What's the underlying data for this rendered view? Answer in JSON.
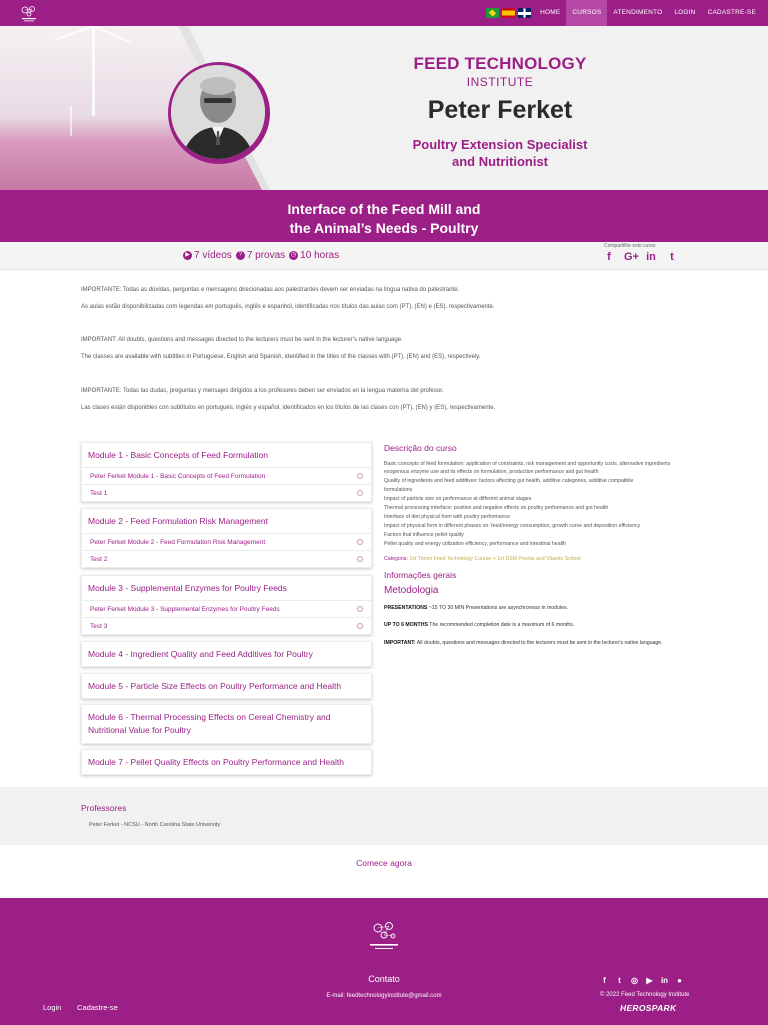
{
  "nav": {
    "items": [
      "HOME",
      "CURSOS",
      "ATENDIMENTO",
      "LOGIN",
      "CADASTRE-SE"
    ],
    "active": "CURSOS",
    "languages": [
      "pt-BR",
      "es",
      "en-GB"
    ]
  },
  "hero": {
    "brand_title": "FEED TECHNOLOGY",
    "brand_subtitle": "INSTITUTE",
    "speaker_name": "Peter Ferket",
    "speaker_role_1": "Poultry Extension Specialist",
    "speaker_role_2": "and Nutritionist"
  },
  "course": {
    "title_line1": "Interface of the Feed Mill and",
    "title_line2": "the Animal’s Needs - Poultry",
    "videos": "7 vídeos",
    "tests": "7 provas",
    "hours": "10 horas",
    "share_label": "Compartilhe este curso"
  },
  "notices": [
    "IMPORTANTE: Todas as dúvidas, perguntas e mensagens direcionadas aos palestrantes devem ser enviadas na língua nativa do palestrante.",
    "As aulas estão disponibilizadas com legendas em português, inglês e espanhol, identificadas nos títulos das aulas com (PT), (EN) e (ES), respectivamente.",
    "IMPORTANT: All doubts, questions and messages directed to the lecturers must be sent in the lecturer’s native language.",
    "The classes are available with subtitles in Portuguese, English and Spanish, identified in the titles of the classes with (PT), (EN) and (ES), respectively.",
    "IMPORTANTE: Todas las dudas, preguntas y mensajes dirigidos a los profesores deben ser enviados en la lengua materna del profesor.",
    "Las clases están disponibles con subtítulos en portugués, inglés y español, identificados en los títulos de las clases con (PT), (EN) y (ES), respectivamente."
  ],
  "modules": [
    {
      "title": "Module 1 - Basic Concepts of Feed Formulation",
      "lessons": [
        "Peter Ferket Module 1 - Basic Concepts of Feed Formulation",
        "Test 1"
      ]
    },
    {
      "title": "Module 2 - Feed Formulation Risk Management",
      "lessons": [
        "Peter Ferket Module 2 - Feed Formulation Risk Management",
        "Test 2"
      ]
    },
    {
      "title": "Module 3 - Supplemental Enzymes for Poultry Feeds",
      "lessons": [
        "Peter Ferket Module 3 - Supplemental Enzymes for Poultry Feeds",
        "Test 3"
      ]
    },
    {
      "title": "Module 4 - Ingredient Quality and Feed Additives for Poultry",
      "lessons": []
    },
    {
      "title": "Module 5 - Particle Size Effects on Poultry Performance and Health",
      "lessons": []
    },
    {
      "title": "Module 6 - Thermal Processing Effects on Cereal Chemistry and Nutritional Value for Poultry",
      "lessons": []
    },
    {
      "title": "Module 7 - Pellet Quality Effects on Poultry Performance and Health",
      "lessons": []
    }
  ],
  "description": {
    "heading": "Descrição do curso",
    "lines": [
      "Basic concepts of feed formulation: application of constraints, risk management and opportunity costs, alternative ingredients",
      "exogenous enzyme use and its effects on formulation, production performance and gut health",
      "Quality of ingredients and feed additives: factors affecting gut health, additive categories, additive compatible",
      "formulations",
      "Impact of particle size on performance at different animal stages",
      "Thermal processing interface: positive and negative effects on poultry performance and gut health",
      "Interface of diet physical form with poultry performance",
      "Impact of physical form in different phases on: feed/energy consumption, growth curve and deposition efficiency",
      "Factors that influence pellet quality",
      "Pellet quality and energy utilization efficiency, performance and intestinal health"
    ],
    "category_label": "Categoria:",
    "category_value": "1st Trimm Feed Technology Course + 1st DSM Premix and Vitamin School",
    "info_heading": "Informações gerais",
    "method_heading": "Metodologia",
    "method_1_bold": "PRESENTATIONS",
    "method_1_text": " ~15 TO 30 MIN Presentations are asynchronous in modules.",
    "method_2_bold": "UP TO 6 MONTHS",
    "method_2_text": " The recommended completion date is a maximum of 6 months.",
    "method_3_bold": "IMPORTANT:",
    "method_3_text": " All doubts, questions and messages directed to the lecturers must be sent in the lecturer's native language."
  },
  "professors": {
    "heading": "Professores",
    "items": [
      "Peter Ferket - NCSU - North Carolina State University"
    ]
  },
  "cta": "Comece agora",
  "footer": {
    "contact_title": "Contato",
    "contact_email": "E-mail: feedtechnologyinstitute@gmail.com",
    "login": "Login",
    "signup": "Cadastre-se",
    "copyright": "© 2022 Feed Technology Institute",
    "powered_by": "HEROSPARK",
    "social": [
      "facebook-icon",
      "twitter-icon",
      "instagram-icon",
      "youtube-icon",
      "linkedin-icon",
      "website-icon"
    ]
  },
  "colors": {
    "brand_purple": "#9b1f86",
    "gold": "#c9a94a"
  }
}
